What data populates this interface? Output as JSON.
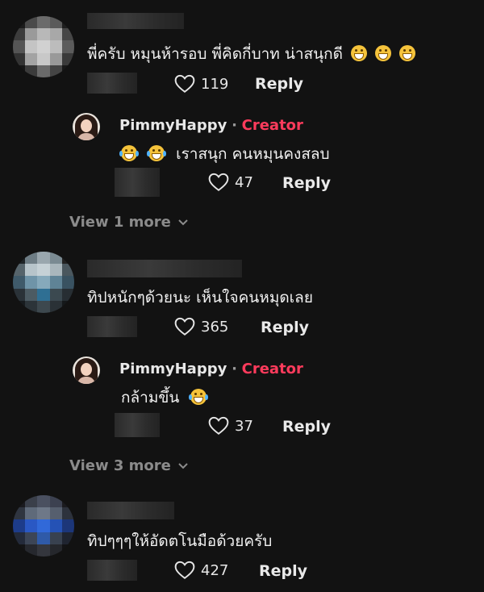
{
  "comments": [
    {
      "text": "พี่ครับ หมุนห้ารอบ พี่คิดกี่บาท น่าสนุกดี",
      "emoji_count": 3,
      "likes": "119",
      "reply_label": "Reply",
      "reply": {
        "username": "PimmyHappy",
        "separator": "·",
        "badge": "Creator",
        "text": "เราสนุก คนหมุนคงสลบ",
        "likes": "47",
        "reply_label": "Reply"
      },
      "view_more": "View 1 more"
    },
    {
      "text": "ทิปหนักๆด้วยนะ เห็นใจคนหมุดเลย",
      "likes": "365",
      "reply_label": "Reply",
      "reply": {
        "username": "PimmyHappy",
        "separator": "·",
        "badge": "Creator",
        "text": "กล้ามขึ้น",
        "likes": "37",
        "reply_label": "Reply"
      },
      "view_more": "View 3 more"
    },
    {
      "text": "ทิปๆๆๆให้อัดตโนมือด้วยครับ",
      "likes": "427",
      "reply_label": "Reply"
    }
  ],
  "colors": {
    "background": "#121212",
    "creator_badge": "#ff3b5c",
    "view_more": "#8b8b8b"
  },
  "icons": [
    "heart-outline-icon",
    "chevron-down-icon",
    "grinning-emoji-icon",
    "tears-of-joy-emoji-icon"
  ]
}
